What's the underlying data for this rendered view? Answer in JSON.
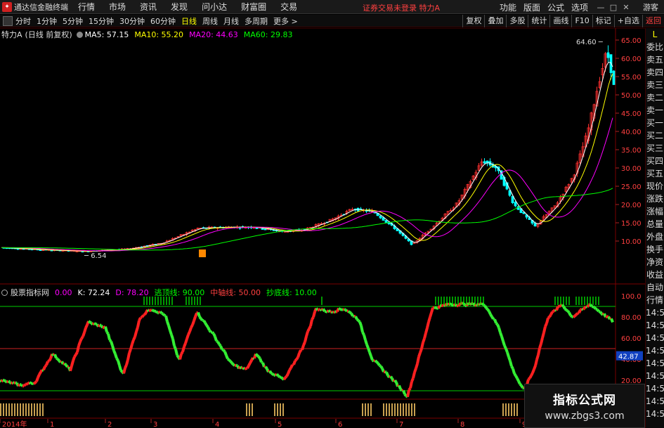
{
  "menubar": {
    "app_title": "通达信金融终端",
    "items": [
      "行情",
      "市场",
      "资讯",
      "发现",
      "问小达",
      "财富圈",
      "交易"
    ],
    "status": "证券交易未登录 特力A",
    "right_items": [
      "功能",
      "版面",
      "公式",
      "选项"
    ],
    "guest": "游客"
  },
  "toolbar": {
    "periods": [
      "分时",
      "1分钟",
      "5分钟",
      "15分钟",
      "30分钟",
      "60分钟",
      "日线",
      "周线",
      "月线",
      "多周期",
      "更多 >"
    ],
    "active_period": "日线",
    "right_buttons": [
      "复权",
      "叠加",
      "多股",
      "统计",
      "画线",
      "F10",
      "标记",
      "+自选",
      "返回"
    ]
  },
  "chart_header": {
    "stock_name": "特力A",
    "mode": "(日线 前复权)",
    "ma": [
      {
        "label": "MA5: 57.15",
        "color": "#ffffff"
      },
      {
        "label": "MA10: 55.20",
        "color": "#ffff00"
      },
      {
        "label": "MA20: 44.63",
        "color": "#ff00ff"
      },
      {
        "label": "MA60: 29.83",
        "color": "#00ff00"
      }
    ]
  },
  "price_axis": [
    "65.00",
    "60.00",
    "55.00",
    "50.00",
    "45.00",
    "40.00",
    "35.00",
    "30.00",
    "25.00",
    "20.00",
    "15.00",
    "10.00"
  ],
  "price_annotations": {
    "high": "64.60",
    "low": "6.54"
  },
  "kdj_header": {
    "name": "股票指标网",
    "items": [
      {
        "label": "0.00",
        "color": "#ff00ff"
      },
      {
        "label": "K: 72.24",
        "color": "#ffffff"
      },
      {
        "label": "D: 78.20",
        "color": "#ff00ff"
      },
      {
        "label": "逃顶线: 90.00",
        "color": "#00ff00"
      },
      {
        "label": "中轴线: 50.00",
        "color": "#ff4040"
      },
      {
        "label": "抄底线: 10.00",
        "color": "#00ff00"
      }
    ]
  },
  "kdj_axis": [
    "100.0",
    "80.00",
    "60.00",
    "40.00",
    "20.00"
  ],
  "kdj_current": "42.87",
  "date_axis": [
    "2014年",
    "1",
    "2",
    "3",
    "4",
    "5",
    "6",
    "7",
    "8",
    "9"
  ],
  "sidebar": [
    "L",
    "委比",
    "卖五",
    "卖四",
    "卖三",
    "卖二",
    "卖一",
    "买一",
    "买二",
    "买三",
    "买四",
    "买五",
    "现价",
    "涨跌",
    "涨幅",
    "总量",
    "外盘",
    "换手",
    "净资",
    "收益",
    "自动",
    "行情",
    "14:50",
    "14:50",
    "14:50",
    "14:50",
    "14:50",
    "14:50",
    "14:50",
    "14:50",
    "14:50"
  ],
  "watermark": {
    "title": "指标公式网",
    "url": "www.zbgs3.com"
  },
  "colors": {
    "up": "#ff3030",
    "down": "#00ffff",
    "k_up": "#ff2020",
    "k_down": "#33ee33"
  }
}
